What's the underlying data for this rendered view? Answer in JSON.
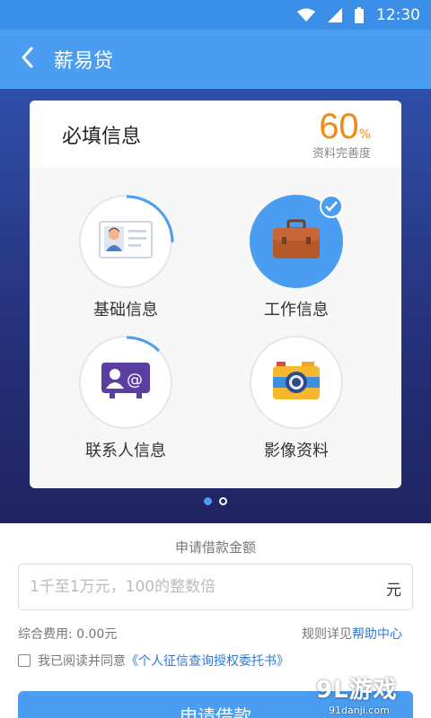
{
  "status_bar": {
    "time": "12:30",
    "icons": [
      "wifi-icon",
      "signal-icon",
      "battery-icon"
    ]
  },
  "header": {
    "title": "薪易贷",
    "back_icon": "chevron-left-icon"
  },
  "card": {
    "title": "必填信息",
    "completion": {
      "value": "60",
      "unit": "%",
      "label": "资料完善度"
    },
    "items": [
      {
        "label": "基础信息",
        "icon": "id-card-icon",
        "progress": 0.25,
        "done": false
      },
      {
        "label": "工作信息",
        "icon": "briefcase-icon",
        "progress": 1.0,
        "done": true
      },
      {
        "label": "联系人信息",
        "icon": "contacts-icon",
        "progress": 0.17,
        "done": false
      },
      {
        "label": "影像资料",
        "icon": "camera-icon",
        "progress": 0,
        "done": false
      }
    ]
  },
  "pager": {
    "count": 2,
    "active": 0
  },
  "form": {
    "amount_label": "申请借款金额",
    "amount_placeholder": "1千至1万元，100的整数倍",
    "amount_unit": "元",
    "fee_label": "综合费用: 0.00元",
    "rules_prefix": "规则详见",
    "rules_link": "帮助中心",
    "agree_prefix": "我已阅读并同意",
    "agree_link": "《个人征信查询授权委托书》",
    "submit_label": "申请借款"
  },
  "watermark": {
    "main": "9L游戏",
    "sub": "91danji.com"
  },
  "colors": {
    "primary": "#4a9df0",
    "accent_orange": "#f28a1a",
    "hero_dark": "#1f2460"
  }
}
